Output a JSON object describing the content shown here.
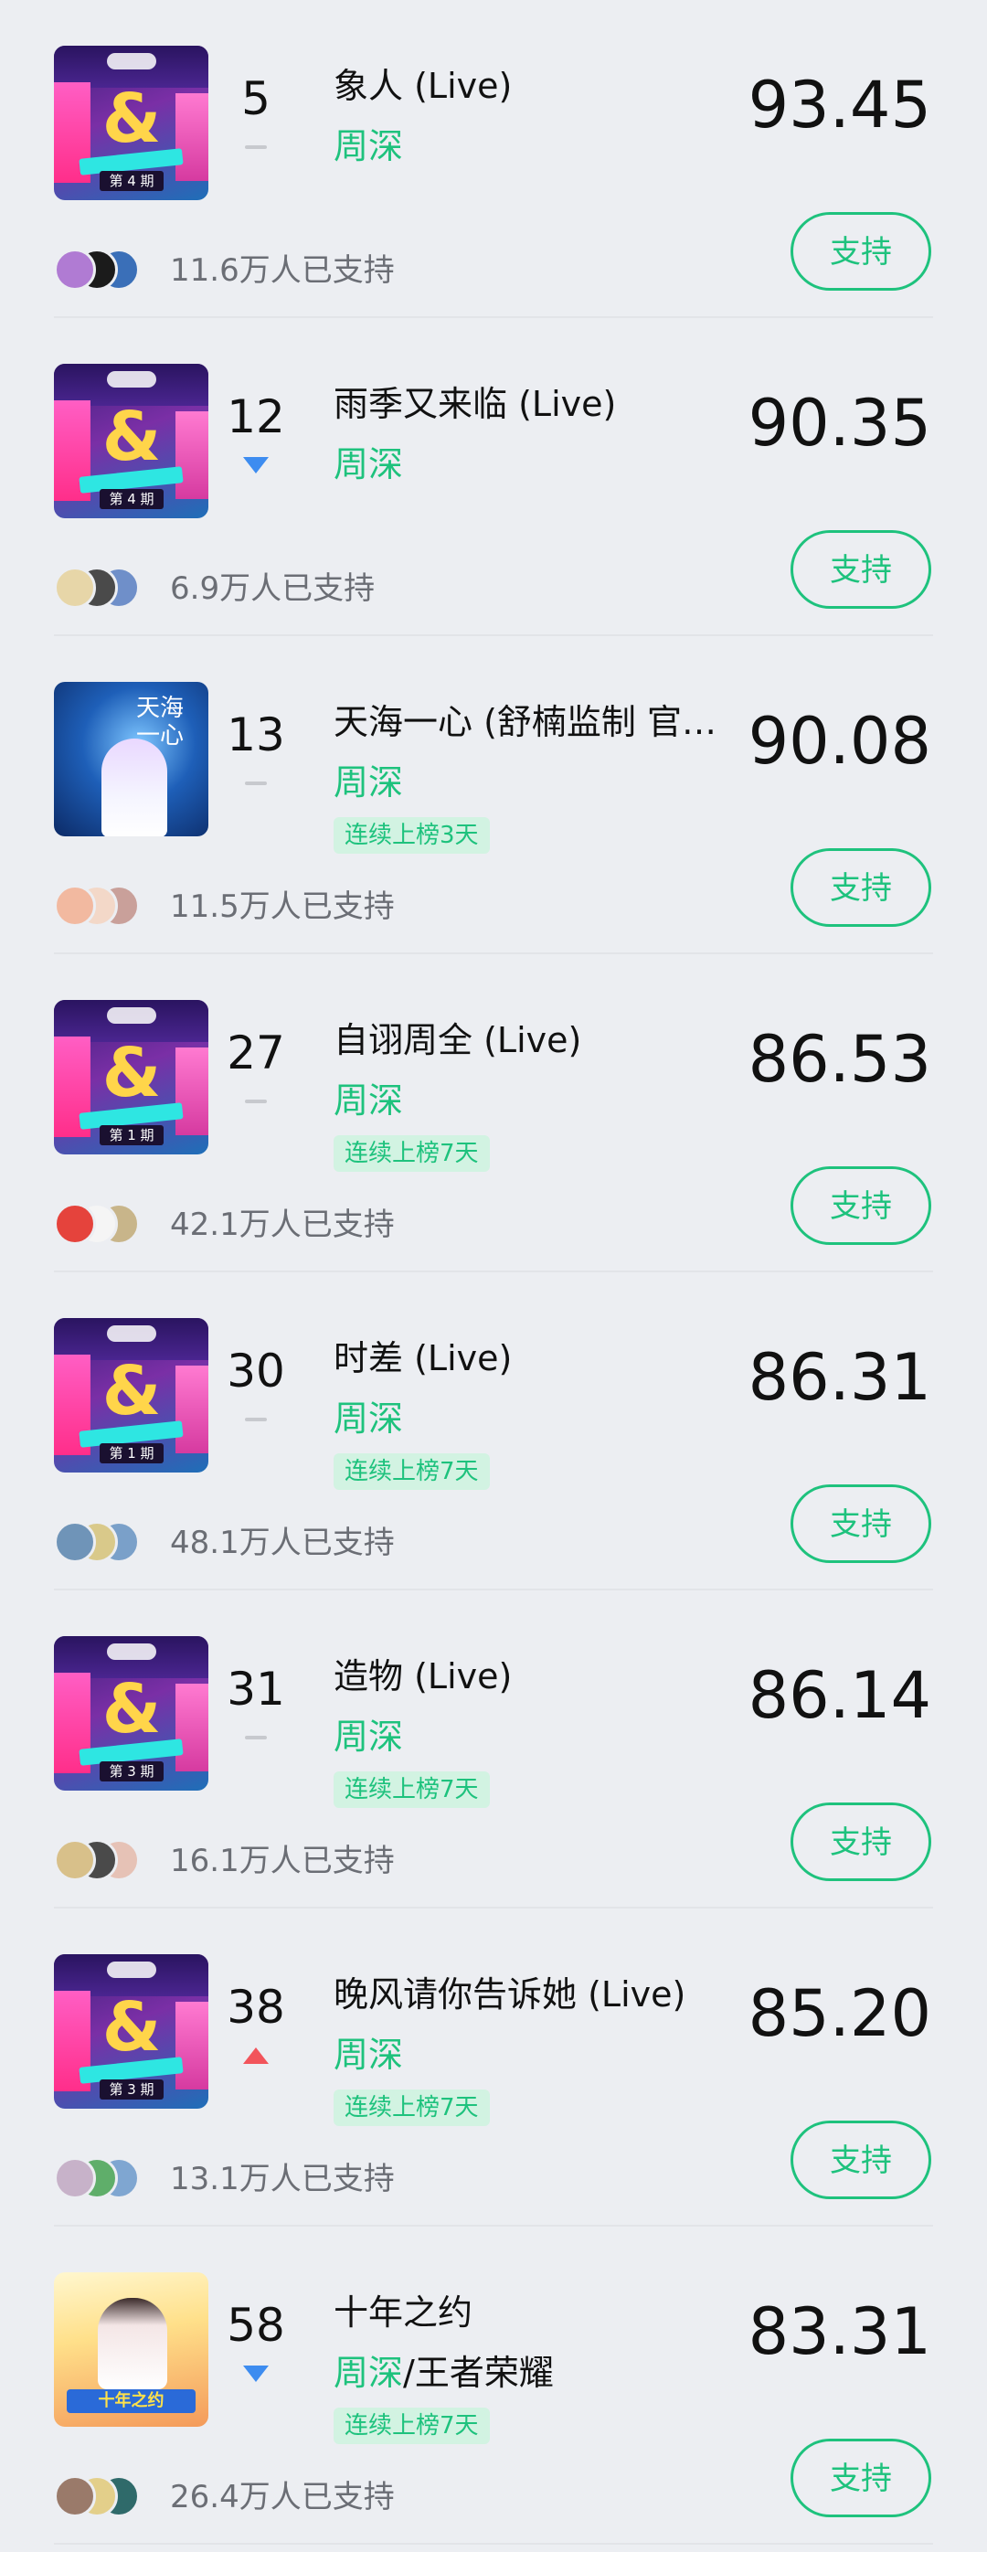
{
  "support_label": "支持",
  "rows": [
    {
      "rank": "5",
      "trend": "flat",
      "title": "象人 (Live)",
      "artist": "周深",
      "artist_extra": "",
      "badge": "",
      "score": "93.45",
      "supporters": "11.6万人已支持",
      "cover": "show",
      "issue": "第 4 期",
      "avatar_colors": [
        "#b07bd3",
        "#1b1b1b",
        "#3a6fb8"
      ]
    },
    {
      "rank": "12",
      "trend": "down",
      "title": "雨季又来临 (Live)",
      "artist": "周深",
      "artist_extra": "",
      "badge": "",
      "score": "90.35",
      "supporters": "6.9万人已支持",
      "cover": "show",
      "issue": "第 4 期",
      "avatar_colors": [
        "#e7d6a8",
        "#4a4a4a",
        "#6f8fc9"
      ]
    },
    {
      "rank": "13",
      "trend": "flat",
      "title": "天海一心 (舒楠监制 官…",
      "artist": "周深",
      "artist_extra": "",
      "badge": "连续上榜3天",
      "score": "90.08",
      "supporters": "11.5万人已支持",
      "cover": "poster-blue",
      "poster_text": "天海一心",
      "avatar_colors": [
        "#f2b9a0",
        "#f3d8c8",
        "#c9a09a"
      ]
    },
    {
      "rank": "27",
      "trend": "flat",
      "title": "自诩周全 (Live)",
      "artist": "周深",
      "artist_extra": "",
      "badge": "连续上榜7天",
      "score": "86.53",
      "supporters": "42.1万人已支持",
      "cover": "show",
      "issue": "第 1 期",
      "avatar_colors": [
        "#e5433c",
        "#f5f5f5",
        "#c8b58a"
      ]
    },
    {
      "rank": "30",
      "trend": "flat",
      "title": "时差 (Live)",
      "artist": "周深",
      "artist_extra": "",
      "badge": "连续上榜7天",
      "score": "86.31",
      "supporters": "48.1万人已支持",
      "cover": "show",
      "issue": "第 1 期",
      "avatar_colors": [
        "#6f94b8",
        "#d9c98a",
        "#7aa0c9"
      ]
    },
    {
      "rank": "31",
      "trend": "flat",
      "title": "造物 (Live)",
      "artist": "周深",
      "artist_extra": "",
      "badge": "连续上榜7天",
      "score": "86.14",
      "supporters": "16.1万人已支持",
      "cover": "show",
      "issue": "第 3 期",
      "avatar_colors": [
        "#d8c08a",
        "#4a4a4a",
        "#e6c2b6"
      ]
    },
    {
      "rank": "38",
      "trend": "up",
      "title": "晚风请你告诉她 (Live)",
      "artist": "周深",
      "artist_extra": "",
      "badge": "连续上榜7天",
      "score": "85.20",
      "supporters": "13.1万人已支持",
      "cover": "show",
      "issue": "第 3 期",
      "avatar_colors": [
        "#c7b2c9",
        "#5fae6a",
        "#7fa6d1"
      ]
    },
    {
      "rank": "58",
      "trend": "down",
      "title": "十年之约",
      "artist": "周深",
      "artist_extra": "/王者荣耀",
      "badge": "连续上榜7天",
      "score": "83.31",
      "supporters": "26.4万人已支持",
      "cover": "poster-warm",
      "poster_text": "十年之约",
      "avatar_colors": [
        "#9a7a6a",
        "#e3cf8a",
        "#2f6a6a"
      ]
    }
  ]
}
